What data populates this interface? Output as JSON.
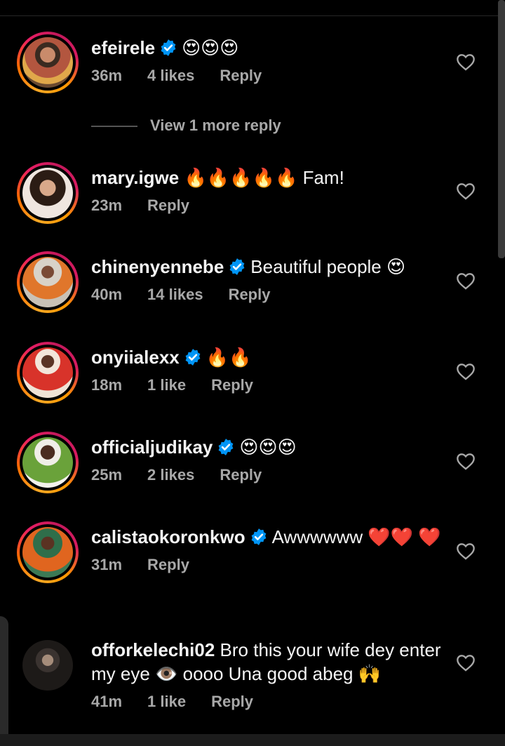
{
  "comments": [
    {
      "username": "efeirele",
      "verified": true,
      "text": "😍😍😍",
      "time": "36m",
      "likes": "4 likes",
      "reply": "Reply"
    },
    {
      "username": "mary.igwe",
      "verified": false,
      "text": "🔥🔥🔥🔥🔥 Fam!",
      "time": "23m",
      "likes": "",
      "reply": "Reply"
    },
    {
      "username": "chinenyennebe",
      "verified": true,
      "text": "Beautiful people 😍",
      "time": "40m",
      "likes": "14 likes",
      "reply": "Reply"
    },
    {
      "username": "onyiialexx",
      "verified": true,
      "text": "🔥🔥",
      "time": "18m",
      "likes": "1 like",
      "reply": "Reply"
    },
    {
      "username": "officialjudikay",
      "verified": true,
      "text": "😍😍😍",
      "time": "25m",
      "likes": "2 likes",
      "reply": "Reply"
    },
    {
      "username": "calistaokoronkwo",
      "verified": true,
      "text": "Awwwwww ❤️❤️ ❤️",
      "time": "31m",
      "likes": "",
      "reply": "Reply"
    },
    {
      "username": "offorkelechi02",
      "verified": false,
      "text": "Bro this your wife dey enter my eye 👁️ oooo  Una good abeg 🙌",
      "time": "41m",
      "likes": "1 like",
      "reply": "Reply"
    }
  ],
  "view_more": "View 1 more reply",
  "colors": {
    "background": "#000000",
    "text": "#f5f5f5",
    "muted": "#a8a8a8",
    "verified": "#0095f6"
  }
}
